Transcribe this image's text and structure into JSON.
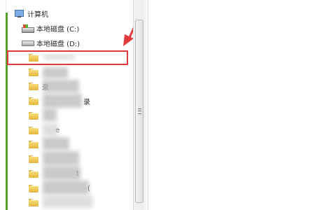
{
  "tree": {
    "computer": {
      "label": "计算机",
      "icon": "computer-icon"
    },
    "drive_c": {
      "label": "本地磁盘 (C:)",
      "icon": "system-drive-icon"
    },
    "drive_d": {
      "label": "本地磁盘 (D:)",
      "icon": "drive-icon"
    },
    "folders": [
      {
        "label": "",
        "icon": "folder-icon"
      },
      {
        "label": "",
        "icon": "folder-icon"
      },
      {
        "label": "录",
        "icon": "folder-icon"
      },
      {
        "label": "",
        "icon": "folder-icon"
      },
      {
        "label": "e",
        "icon": "folder-icon"
      },
      {
        "label": "",
        "icon": "folder-icon"
      },
      {
        "label": "",
        "icon": "folder-icon"
      },
      {
        "label": "t",
        "icon": "folder-icon"
      },
      {
        "label": "",
        "icon": "folder-icon"
      },
      {
        "label": "(",
        "icon": "folder-icon"
      },
      {
        "label": "",
        "icon": "folder-icon"
      }
    ]
  },
  "annotation": {
    "highlight_color": "#e23a3a"
  },
  "colors": {
    "tree_accent": "#5aa02c",
    "folder": "#f0c64e"
  }
}
